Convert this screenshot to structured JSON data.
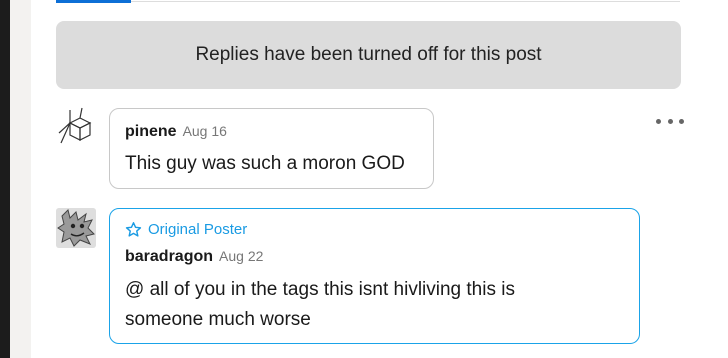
{
  "notice": {
    "text": "Replies have been turned off for this post"
  },
  "comments": [
    {
      "username": "pinene",
      "date": "Aug 16",
      "body": "This guy was such a moron GOD"
    },
    {
      "badge": "Original Poster",
      "username": "baradragon",
      "date": "Aug 22",
      "body": "@ all of you in the tags this isnt hivliving this is someone much worse"
    }
  ],
  "colors": {
    "accent": "#1a9be3",
    "tab": "#0d6fd6",
    "notice_bg": "#dcdcdc"
  },
  "icons": {
    "more": "more-horizontal-icon",
    "badge": "star-icon"
  }
}
